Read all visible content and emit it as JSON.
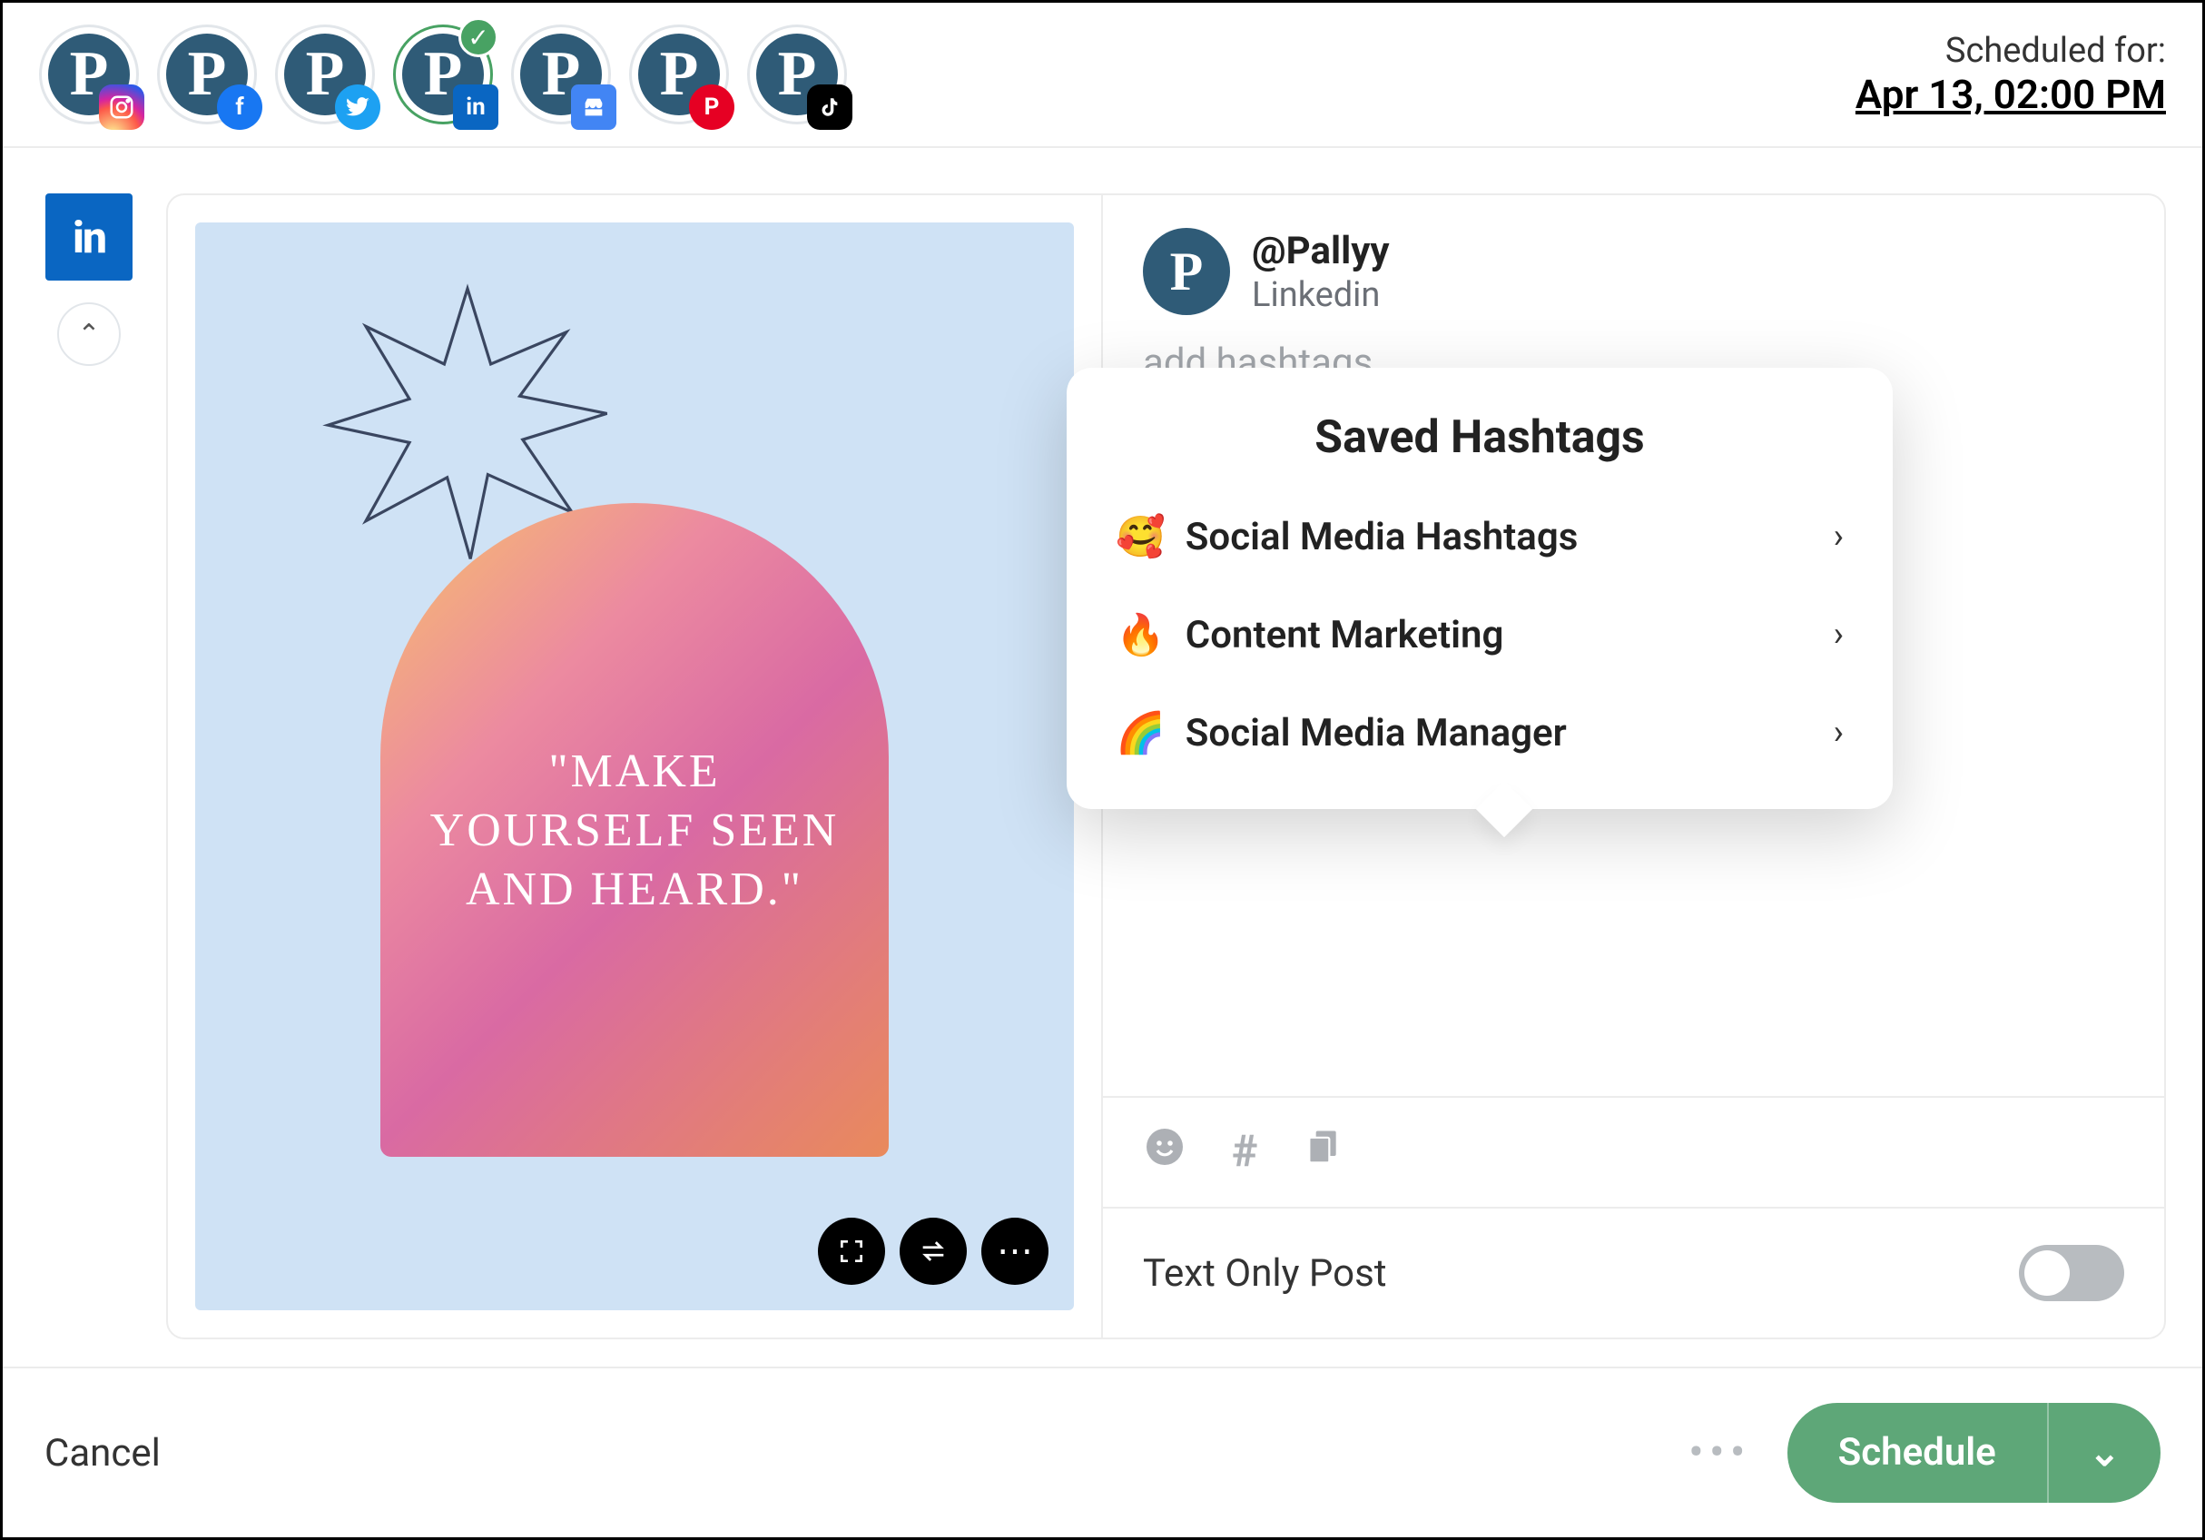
{
  "header": {
    "scheduled_label": "Scheduled for:",
    "scheduled_value": "Apr 13, 02:00 PM",
    "accounts": [
      {
        "network": "instagram",
        "selected": false
      },
      {
        "network": "facebook",
        "selected": false
      },
      {
        "network": "twitter",
        "selected": false
      },
      {
        "network": "linkedin",
        "selected": true
      },
      {
        "network": "google",
        "selected": false
      },
      {
        "network": "pinterest",
        "selected": false
      },
      {
        "network": "tiktok",
        "selected": false
      }
    ]
  },
  "preview": {
    "quote_text": "\"MAKE YOURSELF SEEN AND HEARD.\""
  },
  "compose": {
    "handle": "@Pallyy",
    "network": "Linkedin",
    "placeholder_suffix": "add hashtags.",
    "text_only_label": "Text Only Post",
    "text_only_on": false
  },
  "popover": {
    "title": "Saved Hashtags",
    "items": [
      {
        "emoji": "🥰",
        "label": "Social Media Hashtags"
      },
      {
        "emoji": "🔥",
        "label": "Content Marketing"
      },
      {
        "emoji": "🌈",
        "label": "Social Media Manager"
      }
    ]
  },
  "footer": {
    "cancel_label": "Cancel",
    "schedule_label": "Schedule"
  },
  "colors": {
    "primary_green": "#5ea778",
    "linkedin_blue": "#0a66c2"
  }
}
